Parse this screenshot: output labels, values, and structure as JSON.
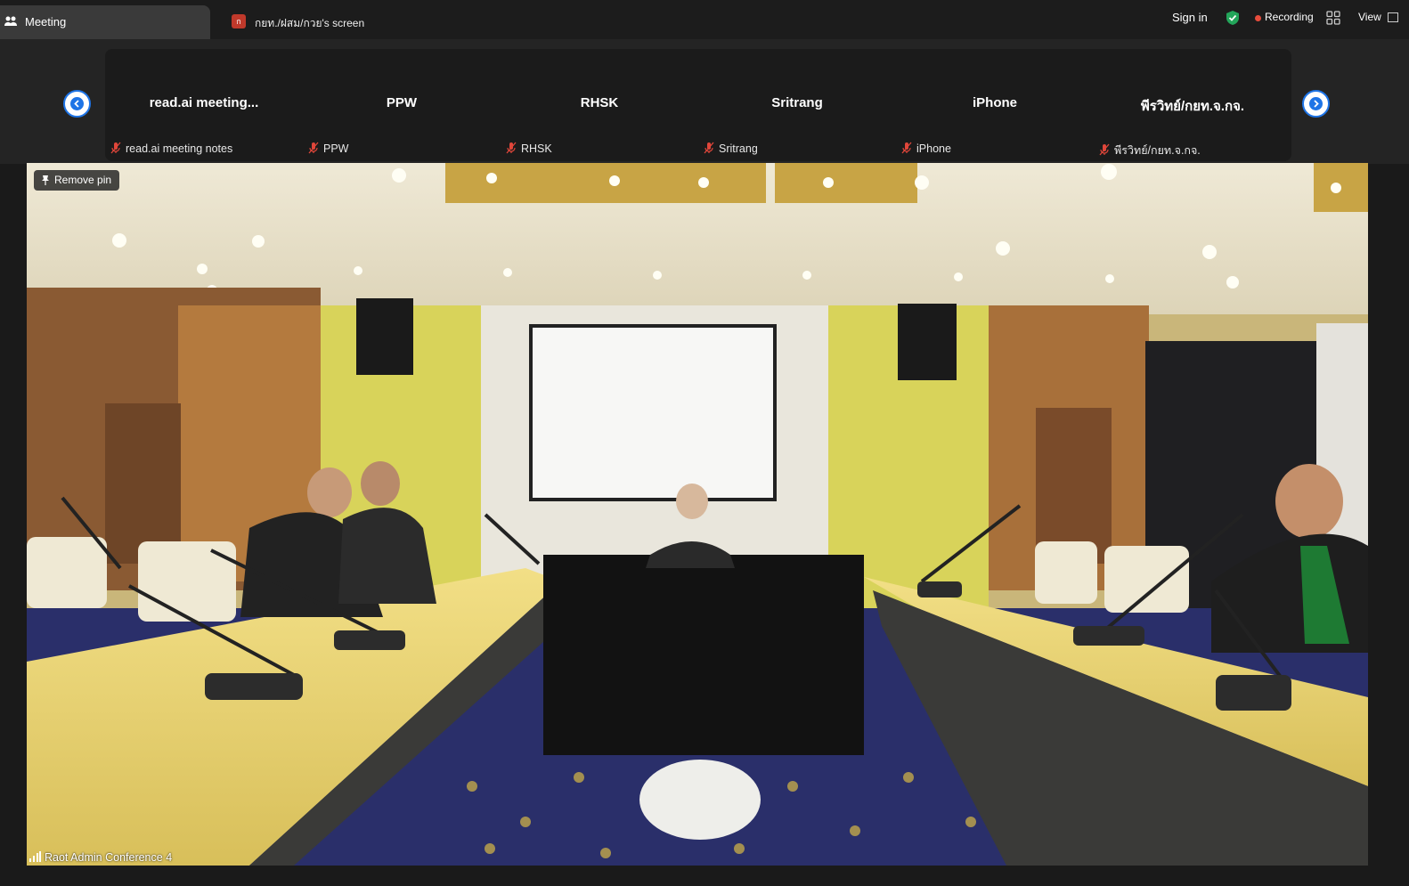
{
  "tabs": {
    "meeting_label": "Meeting",
    "screen_badge": "ก",
    "screen_label": "กยท./ฝสม/กวย's screen"
  },
  "topbar": {
    "sign_in": "Sign in",
    "recording": "Recording",
    "view": "View"
  },
  "gallery": {
    "tiles": [
      {
        "name": "read.ai  meeting...",
        "footer": "read.ai meeting notes"
      },
      {
        "name": "PPW",
        "footer": "PPW"
      },
      {
        "name": "RHSK",
        "footer": "RHSK"
      },
      {
        "name": "Sritrang",
        "footer": "Sritrang"
      },
      {
        "name": "iPhone",
        "footer": "iPhone"
      },
      {
        "name": "พีรวิทย์/กยท.จ.กจ.",
        "footer": "พีรวิทย์/กยท.จ.กจ."
      }
    ]
  },
  "main_video": {
    "remove_pin": "Remove pin",
    "participant": "Raot Admin Conference 4"
  },
  "colors": {
    "accent_blue": "#1e74e6",
    "recording_red": "#e74c3c",
    "secure_green": "#23a55a",
    "muted_red": "#e0463a"
  }
}
